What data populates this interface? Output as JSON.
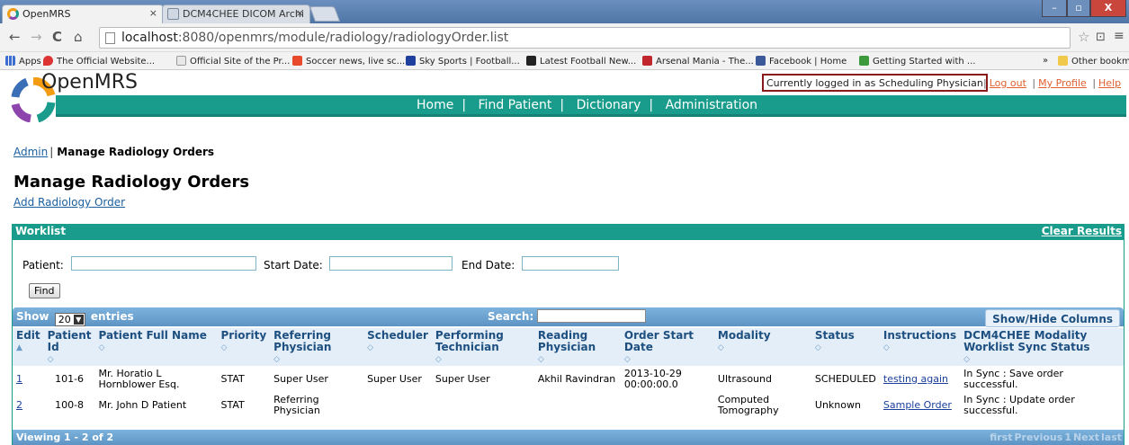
{
  "browser": {
    "tabs": [
      {
        "label": "OpenMRS",
        "active": true
      },
      {
        "label": "DCM4CHEE DICOM Archi",
        "active": false
      }
    ],
    "tab_close": "×",
    "window_controls": [
      "–",
      "▫",
      "X"
    ],
    "url_host": "localhost",
    "url_rest": ":8080/openmrs/module/radiology/radiologyOrder.list",
    "bookmarks": [
      "Apps",
      "The Official Website...",
      "Official Site of the Pr...",
      "Soccer news, live sc...",
      "Sky Sports | Football...",
      "Latest Football New...",
      "Arsenal Mania - The...",
      "Facebook | Home",
      "Getting Started with ...",
      "»",
      "Other bookmarks"
    ],
    "colors": {
      "tabstrip": "#5b82b3",
      "toolbar": "#f2f2f2"
    }
  },
  "header": {
    "brand": "OpenMRS",
    "user_status": "Currently logged in as Scheduling Physician",
    "links": [
      "Log out",
      "My Profile",
      "Help"
    ],
    "separator": "|",
    "nav": [
      "Home",
      "Find Patient",
      "Dictionary",
      "Administration"
    ],
    "colors": {
      "nav_bg": "#1a9c8c",
      "link": "#e06030"
    }
  },
  "breadcrumb": {
    "admin": "Admin",
    "bar": "|",
    "current": "Manage Radiology Orders"
  },
  "page": {
    "title": "Manage Radiology Orders",
    "add_link": "Add Radiology Order"
  },
  "worklist": {
    "heading": "Worklist",
    "clear_results": "Clear Results",
    "filters": {
      "patient": "Patient:",
      "start_date": "Start Date:",
      "end_date": "End Date:"
    },
    "find_button": "Find",
    "show_label": "Show",
    "entries_value": "20",
    "entries_label": "entries",
    "search_label": "Search:",
    "show_hide_columns": "Show/Hide Columns",
    "sort_glyph": "◇",
    "sort_active_glyph": "▲",
    "columns": [
      "Edit",
      "Patient Id",
      "Patient Full Name",
      "Priority",
      "Referring Physician",
      "Scheduler",
      "Performing Technician",
      "Reading Physician",
      "Order Start Date",
      "Modality",
      "Status",
      "Instructions",
      "DCM4CHEE Modality Worklist Sync Status"
    ],
    "rows": [
      {
        "edit": "1",
        "patient_id": "101-6",
        "full_name": "Mr. Horatio L Hornblower Esq.",
        "priority": "STAT",
        "referring": "Super User",
        "scheduler": "Super User",
        "technician": "Super User",
        "reading": "Akhil Ravindran",
        "start_date": "2013-10-29 00:00:00.0",
        "modality": "Ultrasound",
        "status": "SCHEDULED",
        "instructions": "testing again",
        "sync": "In Sync : Save order successful."
      },
      {
        "edit": "2",
        "patient_id": "100-8",
        "full_name": "Mr. John D Patient",
        "priority": "STAT",
        "referring": "Referring Physician",
        "scheduler": "",
        "technician": "",
        "reading": "",
        "start_date": "",
        "modality": "Computed Tomography",
        "status": "Unknown",
        "instructions": "Sample Order",
        "sync": "In Sync : Update order successful."
      }
    ],
    "footer_info": "Viewing 1 - 2 of 2",
    "pager": [
      "first",
      "Previous",
      "1",
      "Next",
      "last"
    ]
  }
}
